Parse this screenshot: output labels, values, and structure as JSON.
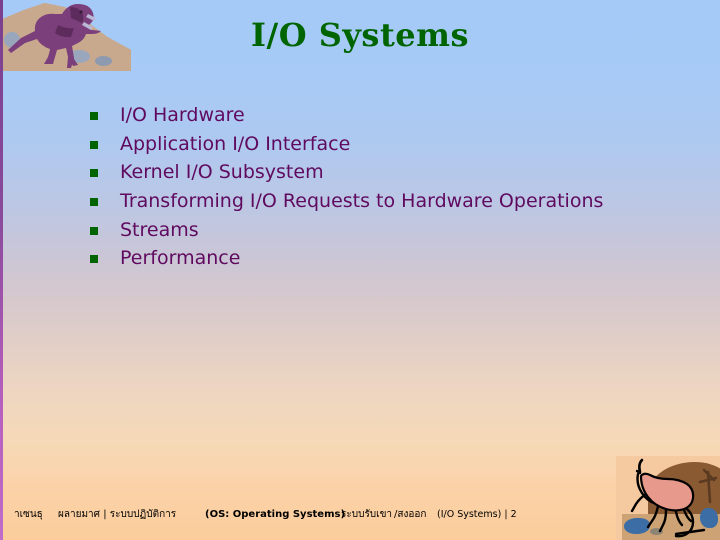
{
  "slide": {
    "title": "I/O Systems",
    "title_color": "#006400",
    "bullet_color": "#006400",
    "text_color": "#5f0a5f",
    "bullets": [
      {
        "label": "I/O Hardware"
      },
      {
        "label": "Application I/O Interface"
      },
      {
        "label": "Kernel I/O Subsystem"
      },
      {
        "label": "Transforming I/O Requests to Hardware Operations"
      },
      {
        "label": "Streams"
      },
      {
        "label": "Performance"
      }
    ]
  },
  "footer": {
    "author": "าเซนธุ",
    "affiliation": "ผลายมาศ | ระบบปฏิบัติการ",
    "course": "(OS: Operating Systems)",
    "separator": "|",
    "topic_thai": "ระบบรับเขา",
    "topic_thai_2": "/สงออก",
    "topic_en": "(I/O Systems)",
    "page_separator": "|",
    "page_number": "2"
  },
  "decorations": {
    "top_left": "dinosaur-hillside-image",
    "bottom_right": "dinosaur-desert-image"
  }
}
